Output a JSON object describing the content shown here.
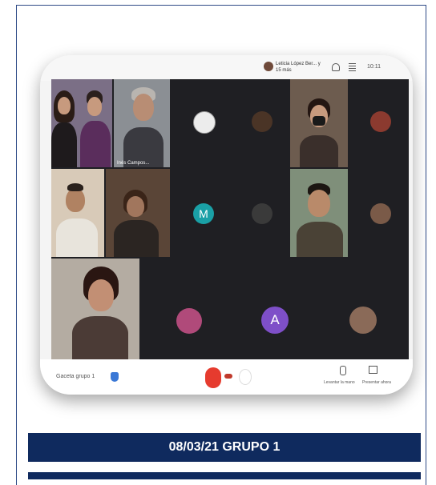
{
  "caption": "08/03/21 GRUPO 1",
  "meeting": {
    "presenter_label": "Leticia López Ber... y 15 más",
    "clock": "10:11",
    "bottom_left_label": "Gaceta grupo 1",
    "raise_hand_label": "Levantar la mano",
    "present_label": "Presentar ahora",
    "participant_name_label": "Inés Campos...",
    "avatar_letters": [
      "M",
      "A"
    ]
  }
}
